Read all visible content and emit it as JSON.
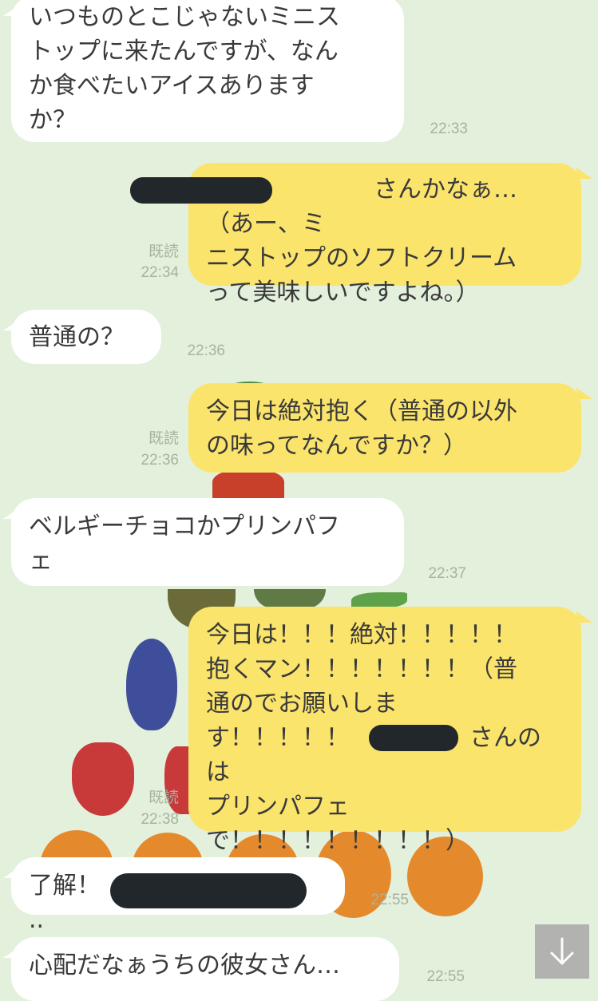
{
  "messages": [
    {
      "side": "in",
      "text": "いつものとこじゃないミニス\nトップに来たんですが、なん\nか食べたいアイスあります\nか？",
      "time": "22:33"
    },
    {
      "side": "out",
      "text": "　　　　　　　さんかなぁ…（あー、ミ\nニストップのソフトクリーム\nって美味しいですよね。）",
      "read": "既読",
      "time": "22:34"
    },
    {
      "side": "in",
      "text": "普通の？",
      "time": "22:36"
    },
    {
      "side": "out",
      "text": "今日は絶対抱く（普通の以外\nの味ってなんですか？）",
      "read": "既読",
      "time": "22:36"
    },
    {
      "side": "in",
      "text": "ベルギーチョコかプリンパフ\nェ",
      "time": "22:37"
    },
    {
      "side": "out",
      "text": "今日は！！！絶対！！！！！\n抱くマン！！！！！！！（普\n通のでお願いしま\nす！！！！！　　　　　さんのは\nプリンパフェ\nで！！！！！！！！！）",
      "read": "既読",
      "time": "22:38"
    },
    {
      "side": "in",
      "text": "了解！　　　　　　　　　　..",
      "time": "22:55"
    },
    {
      "side": "in",
      "text": "心配だなぁうちの彼女さん…",
      "time": "22:55"
    }
  ],
  "icons": {
    "scroll_down": "arrow-down-icon"
  },
  "colors": {
    "background": "#e3f0dc",
    "incoming": "#ffffff",
    "outgoing": "#fbe46b",
    "meta": "#a6b3a0"
  }
}
